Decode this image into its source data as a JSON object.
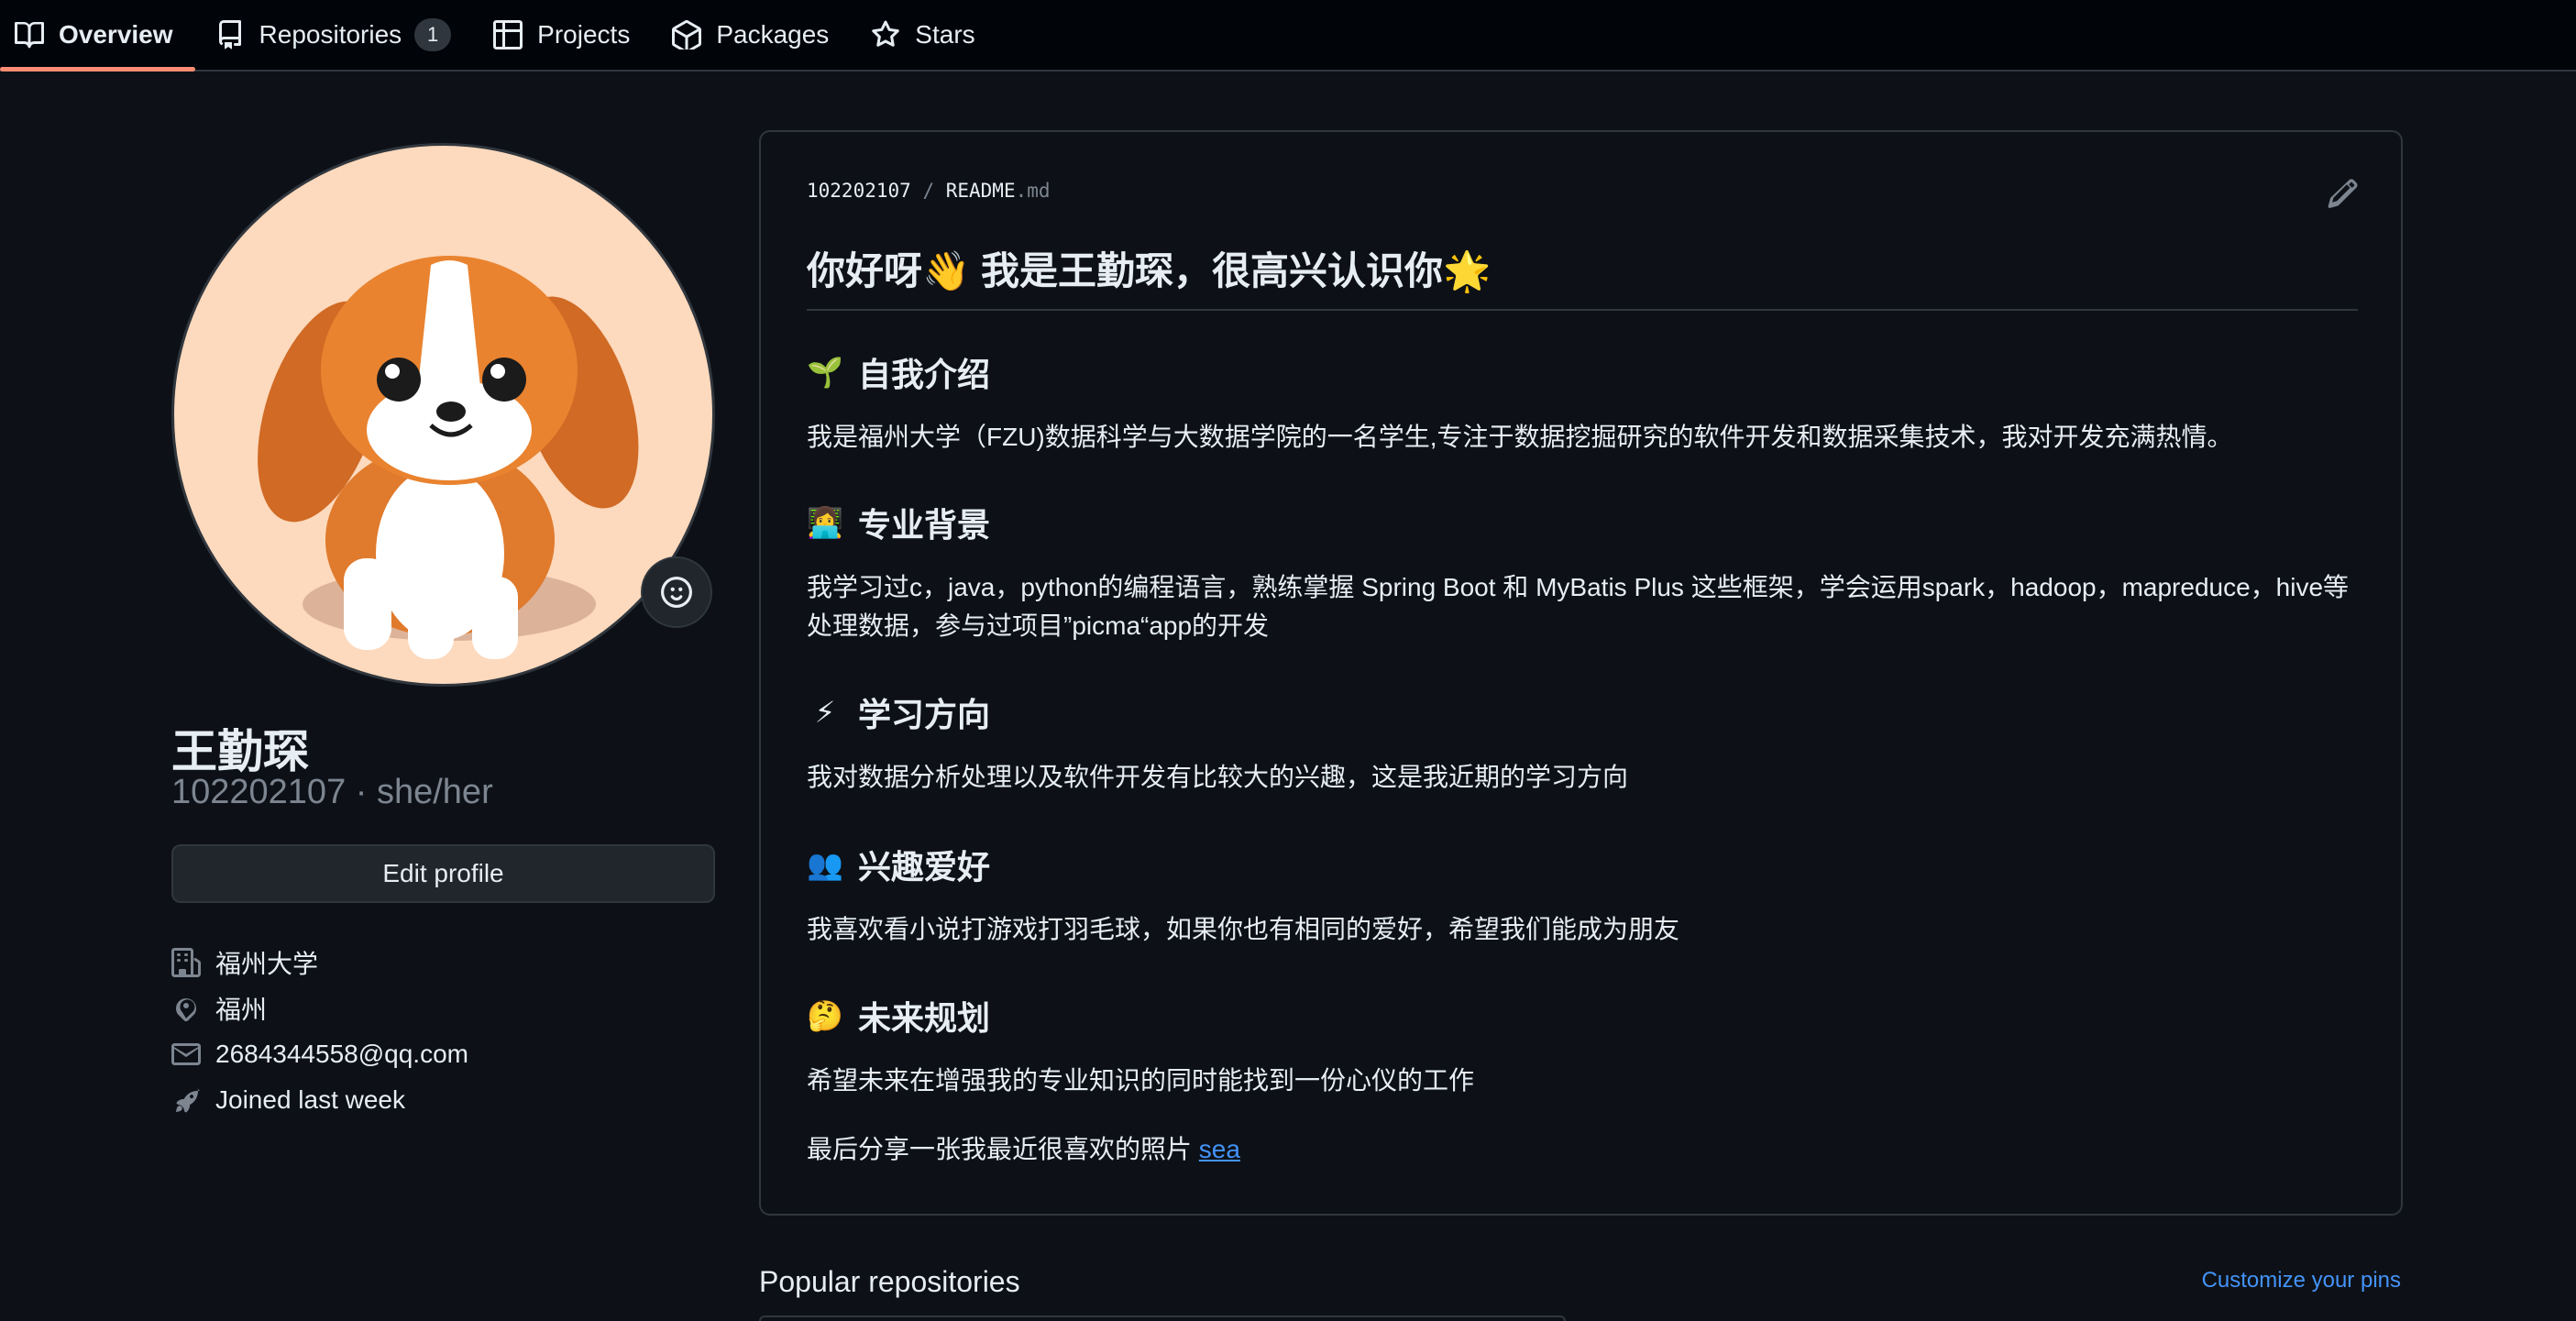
{
  "nav": {
    "tabs": [
      {
        "label": "Overview",
        "icon": "book-icon",
        "active": true
      },
      {
        "label": "Repositories",
        "icon": "repo-icon",
        "count": "1"
      },
      {
        "label": "Projects",
        "icon": "table-icon"
      },
      {
        "label": "Packages",
        "icon": "package-icon"
      },
      {
        "label": "Stars",
        "icon": "star-icon"
      }
    ]
  },
  "profile": {
    "name": "王勤琛",
    "username": "102202107",
    "pronouns_line": "102202107 · she/her",
    "edit_label": "Edit profile",
    "details": [
      {
        "icon": "organization-icon",
        "text": "福州大学"
      },
      {
        "icon": "location-icon",
        "text": "福州"
      },
      {
        "icon": "mail-icon",
        "text": "2684344558@qq.com"
      },
      {
        "icon": "rocket-icon",
        "text": "Joined last week"
      }
    ]
  },
  "readme": {
    "path_user": "102202107",
    "path_sep": " / ",
    "path_file": "README",
    "path_ext": ".md",
    "heading": "你好呀👋 我是王勤琛，很高兴认识你🌟",
    "sections": [
      {
        "emoji": "🌱",
        "title": "自我介绍",
        "body": "我是福州大学（FZU)数据科学与大数据学院的一名学生,专注于数据挖掘研究的软件开发和数据采集技术，我对开发充满热情。"
      },
      {
        "emoji": "👩‍💻",
        "title": "专业背景",
        "body": "我学习过c，java，python的编程语言，熟练掌握 Spring Boot 和 MyBatis Plus 这些框架，学会运用spark，hadoop，mapreduce，hive等处理数据，参与过项目”picma“app的开发"
      },
      {
        "emoji": "⚡",
        "title": "学习方向",
        "body": "我对数据分析处理以及软件开发有比较大的兴趣，这是我近期的学习方向"
      },
      {
        "emoji": "👥",
        "title": "兴趣爱好",
        "body": "我喜欢看小说打游戏打羽毛球，如果你也有相同的爱好，希望我们能成为朋友"
      },
      {
        "emoji": "🤔",
        "title": "未来规划",
        "body": "希望未来在增强我的专业知识的同时能找到一份心仪的工作"
      }
    ],
    "closing_text": "最后分享一张我最近很喜欢的照片 ",
    "closing_link": "sea"
  },
  "popular": {
    "title": "Popular repositories",
    "customize_label": "Customize your pins"
  },
  "colors": {
    "background": "#0d1117",
    "nav_bg": "#010409",
    "border": "#30363d",
    "active_underline": "#fd8c73",
    "link": "#4493f8",
    "avatar_bg": "#fdd9bd"
  }
}
